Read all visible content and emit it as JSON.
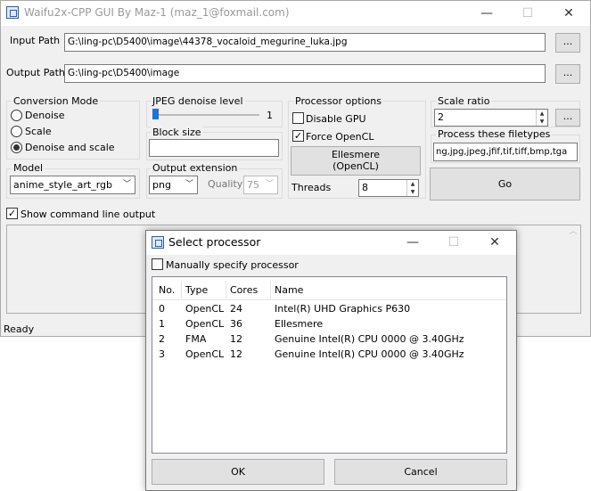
{
  "window": {
    "title": "Waifu2x-CPP GUI By Maz-1 (maz_1@foxmail.com)",
    "input_path_label": "Input Path",
    "input_path_value": "G:\\ling-pc\\D5400\\image\\44378_vocaloid_megurine_luka.jpg",
    "output_path_label": "Output Path",
    "output_path_value": "G:\\ling-pc\\D5400\\image",
    "browse_label": "..."
  },
  "conversion_mode": {
    "label": "Conversion Mode",
    "options": [
      "Denoise",
      "Scale",
      "Denoise and scale"
    ],
    "selected": "Denoise and scale"
  },
  "jpeg_denoise": {
    "label": "JPEG denoise level",
    "value": "1",
    "level_fraction": 0.0
  },
  "block_size": {
    "label": "Block size",
    "value": ""
  },
  "model": {
    "label": "Model",
    "value": "anime_style_art_rgb"
  },
  "output_extension": {
    "label": "Output extension",
    "format": "png",
    "quality_label": "Quality",
    "quality_value": "75"
  },
  "processor_options": {
    "label": "Processor options",
    "disable_gpu_label": "Disable GPU",
    "disable_gpu_checked": false,
    "force_opencl_label": "Force OpenCL",
    "force_opencl_checked": true,
    "processor_button_line1": "Ellesmere",
    "processor_button_line2": "(OpenCL)",
    "threads_label": "Threads",
    "threads_value": "8"
  },
  "scale_ratio": {
    "label": "Scale ratio",
    "value": "2",
    "browse_label": "..."
  },
  "filetypes": {
    "label": "Process these filetypes",
    "value": "ng,jpg,jpeg,jfif,tif,tiff,bmp,tga"
  },
  "go_label": "Go",
  "show_cmd": {
    "label": "Show command line output",
    "checked": true
  },
  "status": "Ready",
  "dialog": {
    "title": "Select processor",
    "manual_label": "Manually specify processor",
    "manual_checked": false,
    "columns": [
      "No.",
      "Type",
      "Cores",
      "Name"
    ],
    "rows": [
      {
        "no": "0",
        "type": "OpenCL",
        "cores": "24",
        "name": "Intel(R) UHD Graphics P630"
      },
      {
        "no": "1",
        "type": "OpenCL",
        "cores": "36",
        "name": "Ellesmere"
      },
      {
        "no": "2",
        "type": "FMA",
        "cores": "12",
        "name": "Genuine Intel(R) CPU 0000 @ 3.40GHz"
      },
      {
        "no": "3",
        "type": "OpenCL",
        "cores": "12",
        "name": "Genuine Intel(R) CPU 0000 @ 3.40GHz"
      }
    ],
    "ok_label": "OK",
    "cancel_label": "Cancel"
  }
}
